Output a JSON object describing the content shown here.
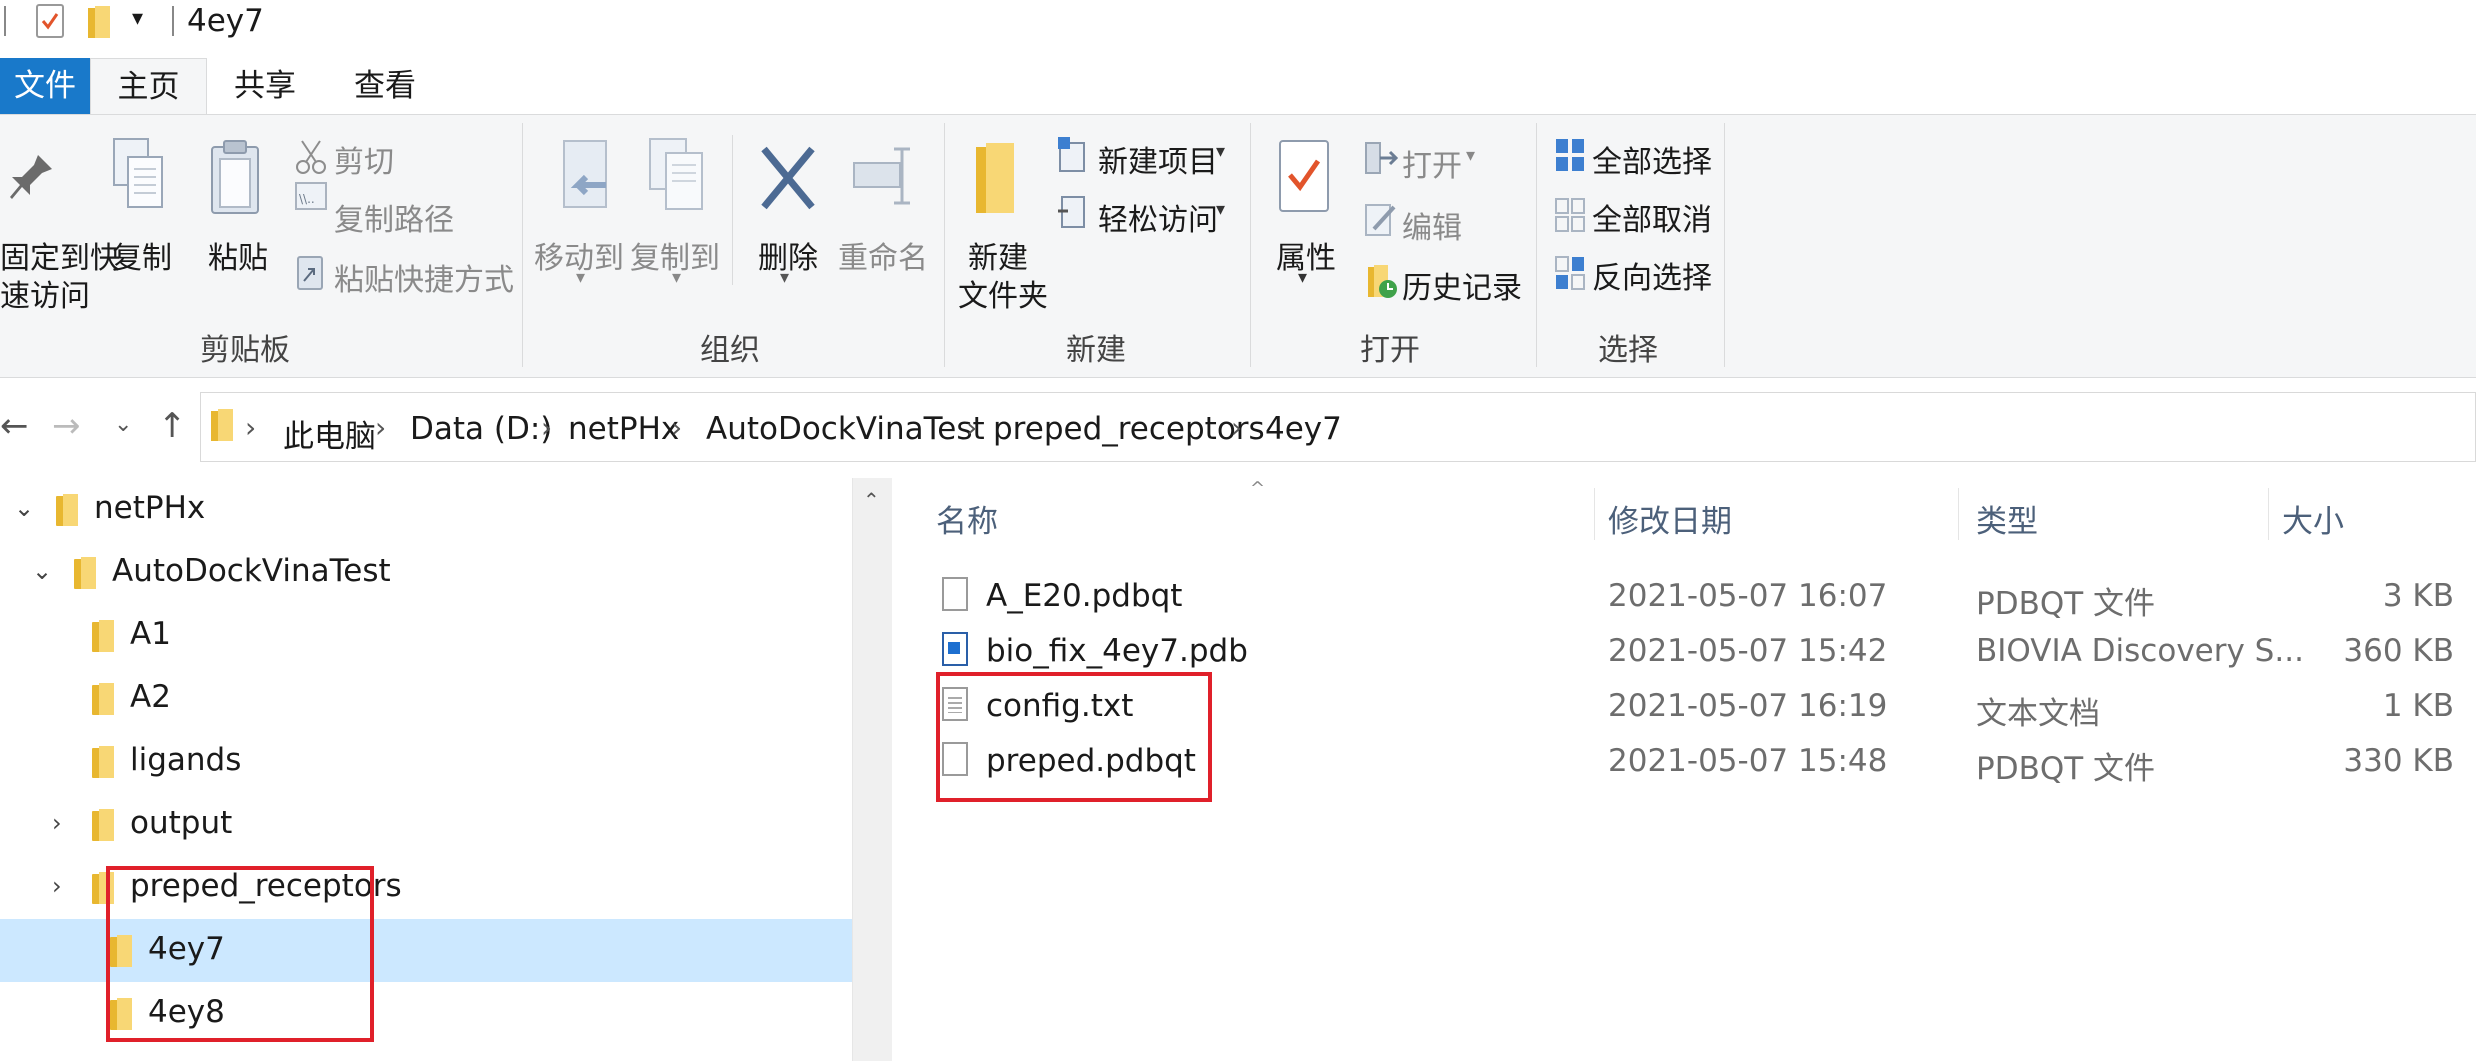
{
  "window": {
    "title": "4ey7"
  },
  "tabs": {
    "file": "文件",
    "home": "主页",
    "share": "共享",
    "view": "查看"
  },
  "ribbon": {
    "clipboard": {
      "pin_line1": "固定到快",
      "pin_line2": "速访问",
      "copy": "复制",
      "paste": "粘贴",
      "cut": "剪切",
      "copy_path": "复制路径",
      "paste_shortcut": "粘贴快捷方式",
      "group": "剪贴板"
    },
    "organize": {
      "move_to": "移动到",
      "copy_to": "复制到",
      "delete": "删除",
      "rename": "重命名",
      "group": "组织"
    },
    "new": {
      "new_folder_line1": "新建",
      "new_folder_line2": "文件夹",
      "new_item": "新建项目",
      "easy_access": "轻松访问",
      "group": "新建"
    },
    "open": {
      "properties": "属性",
      "open": "打开",
      "edit": "编辑",
      "history": "历史记录",
      "group": "打开"
    },
    "select": {
      "select_all": "全部选择",
      "select_none": "全部取消",
      "invert": "反向选择",
      "group": "选择"
    }
  },
  "address": {
    "crumbs": [
      "此电脑",
      "Data (D:)",
      "netPHx",
      "AutoDockVinaTest",
      "preped_receptors",
      "4ey7"
    ]
  },
  "tree": {
    "items": [
      {
        "label": "netPHx"
      },
      {
        "label": "AutoDockVinaTest"
      },
      {
        "label": "A1"
      },
      {
        "label": "A2"
      },
      {
        "label": "ligands"
      },
      {
        "label": "output"
      },
      {
        "label": "preped_receptors"
      },
      {
        "label": "4ey7"
      },
      {
        "label": "4ey8"
      }
    ]
  },
  "files": {
    "columns": {
      "name": "名称",
      "date": "修改日期",
      "type": "类型",
      "size": "大小"
    },
    "rows": [
      {
        "name": "A_E20.pdbqt",
        "date": "2021-05-07 16:07",
        "type": "PDBQT 文件",
        "size": "3 KB"
      },
      {
        "name": "bio_fix_4ey7.pdb",
        "date": "2021-05-07 15:42",
        "type": "BIOVIA Discovery S...",
        "size": "360 KB"
      },
      {
        "name": "config.txt",
        "date": "2021-05-07 16:19",
        "type": "文本文档",
        "size": "1 KB"
      },
      {
        "name": "preped.pdbqt",
        "date": "2021-05-07 15:48",
        "type": "PDBQT 文件",
        "size": "330 KB"
      }
    ]
  },
  "colors": {
    "accent": "#1979ca",
    "selection": "#cce8ff",
    "highlight_box": "#e0202a",
    "folder": "#f8d775"
  }
}
